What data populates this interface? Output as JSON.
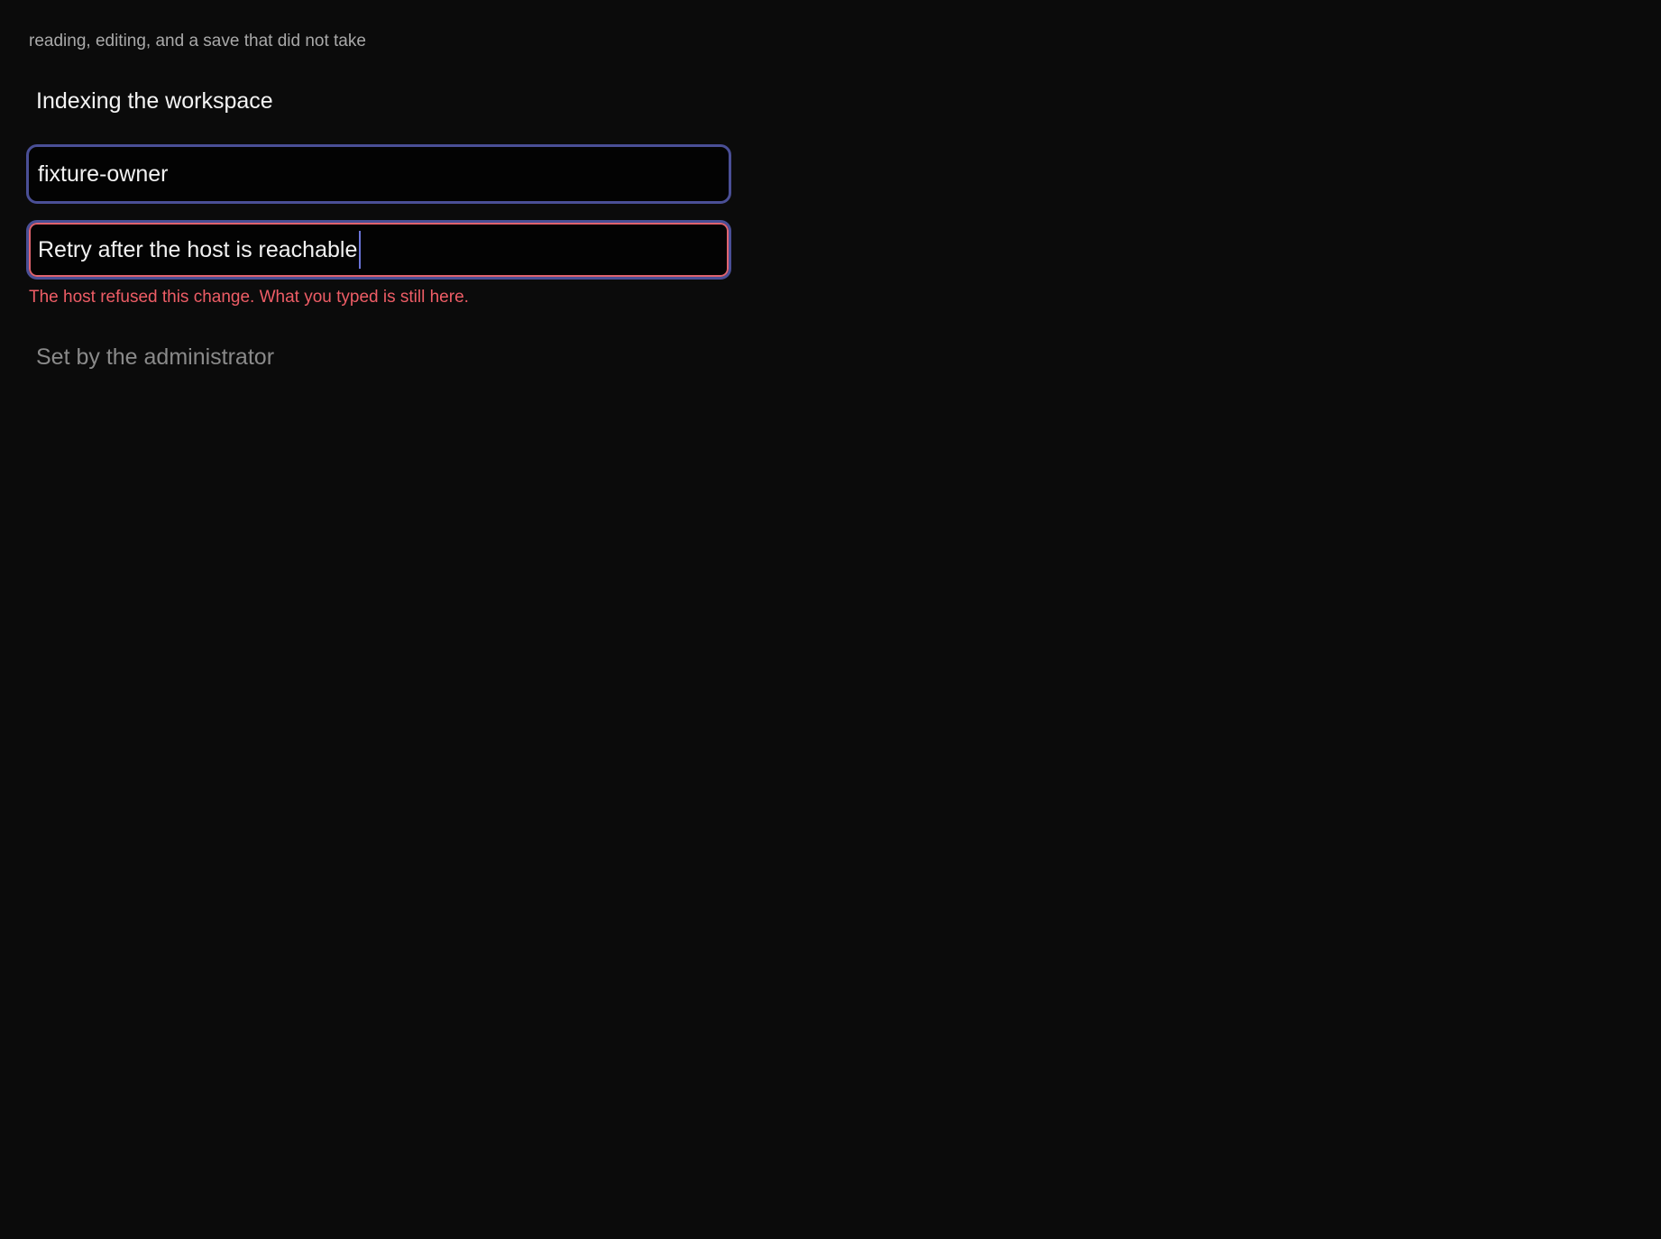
{
  "caption": "reading, editing, and a save that did not take",
  "section_title": "Indexing the workspace",
  "owner_field": {
    "value": "fixture-owner"
  },
  "note_field": {
    "value": "Retry after the host is reachable",
    "error": "The host refused this change. What you typed is still here."
  },
  "readonly_value": "Set by the administrator",
  "colors": {
    "background": "#0b0b0b",
    "field_border": "#4a4f96",
    "error": "#ee5d66",
    "muted_text": "#8a8a8a"
  }
}
